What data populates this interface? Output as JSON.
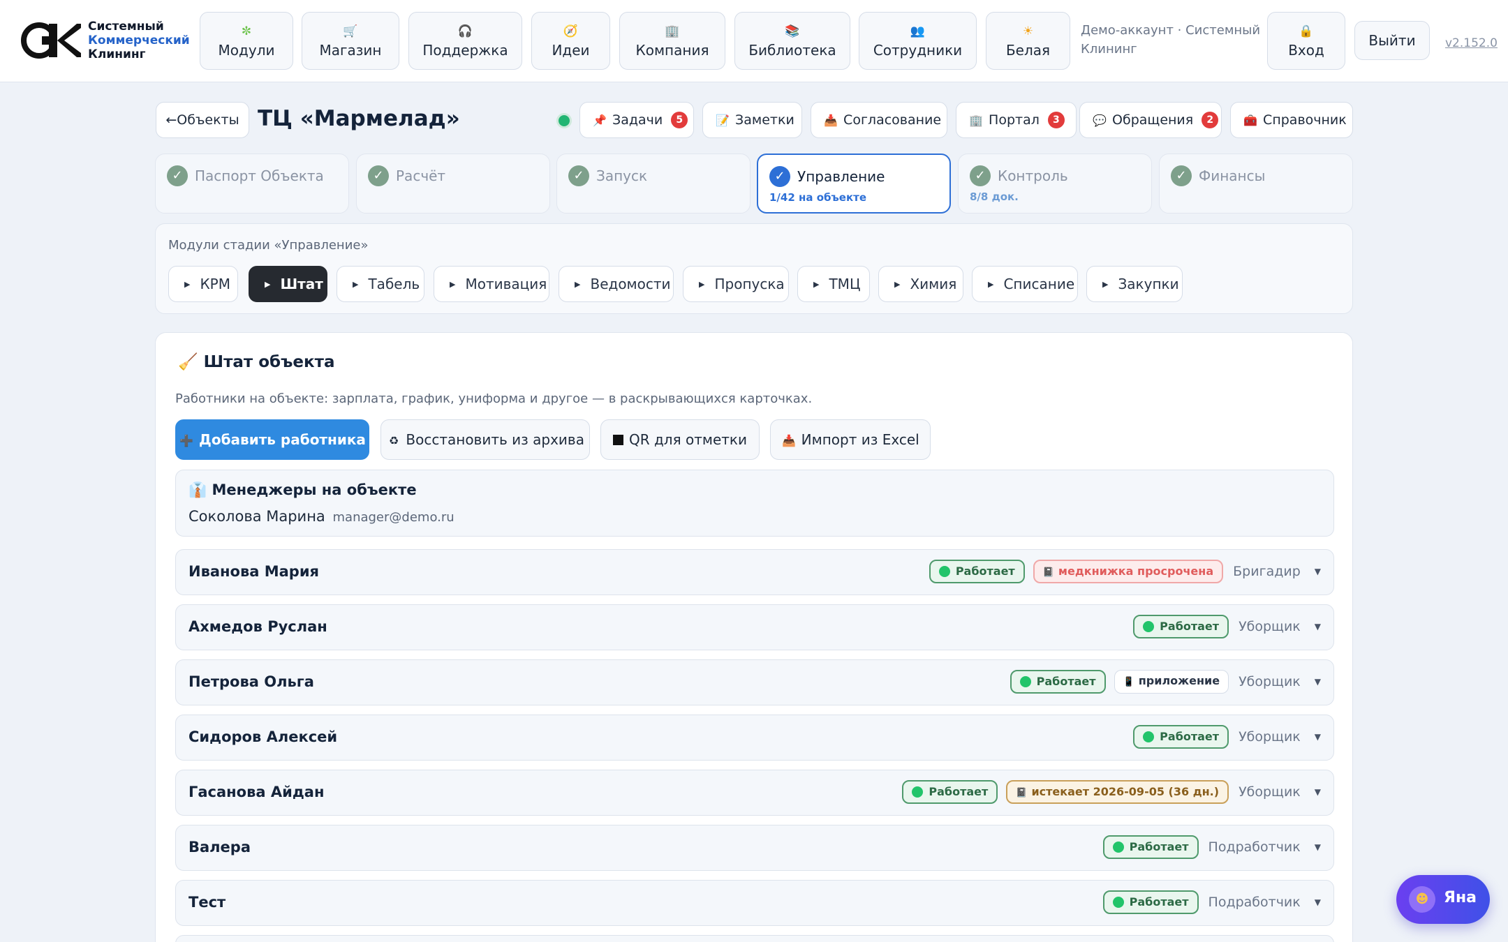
{
  "brand": {
    "line1": "Системный",
    "line2": "Коммерческий",
    "line3": "Клининг",
    "accent_color": "#2563c9"
  },
  "nav": [
    {
      "label": "Модули",
      "icon": "puzzle-icon",
      "glyph": "✼"
    },
    {
      "label": "Магазин",
      "icon": "cart-icon",
      "glyph": "🛒"
    },
    {
      "label": "Поддержка",
      "icon": "headphones-icon",
      "glyph": "🎧"
    },
    {
      "label": "Идеи",
      "icon": "compass-icon",
      "glyph": "🧭"
    },
    {
      "label": "Компания",
      "icon": "office-building-icon",
      "glyph": "🏢"
    },
    {
      "label": "Библиотека",
      "icon": "books-icon",
      "glyph": "📚"
    },
    {
      "label": "Сотрудники",
      "icon": "people-icon",
      "glyph": "👥"
    },
    {
      "label": "Белая",
      "icon": "sun-icon",
      "glyph": "☀"
    }
  ],
  "account": {
    "demo_text": "Демо-аккаунт · Системный Клининг",
    "login_label": "Вход",
    "login_icon": "lock-icon",
    "login_glyph": "🔒",
    "logout_label": "Выйти",
    "version": "v2.152.0"
  },
  "header": {
    "back_label": "←Объекты",
    "title": "ТЦ «Мармелад»",
    "status_color": "#22b573",
    "buttons": [
      {
        "label": "Задачи",
        "icon": "pin-icon",
        "glyph": "📌",
        "badge": "5"
      },
      {
        "label": "Заметки",
        "icon": "memo-icon",
        "glyph": "📝",
        "badge": ""
      },
      {
        "label": "Согласование",
        "icon": "inbox-tray-icon",
        "glyph": "📥",
        "badge": ""
      },
      {
        "label": "Портал",
        "icon": "building-icon",
        "glyph": "🏢",
        "badge": "3"
      },
      {
        "label": "Обращения",
        "icon": "speech-bubble-icon",
        "glyph": "💬",
        "badge": "2"
      },
      {
        "label": "Справочник",
        "icon": "toolbox-icon",
        "glyph": "🧰",
        "badge": ""
      }
    ]
  },
  "stages": [
    {
      "label": "Паспорт Объекта",
      "sub": "",
      "active": false
    },
    {
      "label": "Расчёт",
      "sub": "",
      "active": false
    },
    {
      "label": "Запуск",
      "sub": "",
      "active": false
    },
    {
      "label": "Управление",
      "sub": "1/42 на объекте",
      "active": true
    },
    {
      "label": "Контроль",
      "sub": "8/8 док.",
      "active": false
    },
    {
      "label": "Финансы",
      "sub": "",
      "active": false
    }
  ],
  "modules": {
    "caption": "Модули стадии «Управление»",
    "items": [
      {
        "label": "КРМ",
        "active": false
      },
      {
        "label": "Штат",
        "active": true
      },
      {
        "label": "Табель",
        "active": false
      },
      {
        "label": "Мотивация",
        "active": false
      },
      {
        "label": "Ведомости",
        "active": false
      },
      {
        "label": "Пропуска",
        "active": false
      },
      {
        "label": "ТМЦ",
        "active": false
      },
      {
        "label": "Химия",
        "active": false
      },
      {
        "label": "Списание",
        "active": false
      },
      {
        "label": "Закупки",
        "active": false
      }
    ]
  },
  "staff": {
    "title": "Штат объекта",
    "title_icon": "cleaner-person-icon",
    "title_glyph": "🧹",
    "description": "Работники на объекте: зарплата, график, униформа и другое — в раскрывающихся карточках.",
    "actions": [
      {
        "label": "Добавить работника",
        "icon": "plus-icon",
        "glyph": "➕",
        "primary": true
      },
      {
        "label": "Восстановить из архива",
        "icon": "recycle-icon",
        "glyph": "♻",
        "primary": false
      },
      {
        "label": "QR для отметки",
        "icon": "qr-icon",
        "glyph": "",
        "primary": false
      },
      {
        "label": "Импорт из Excel",
        "icon": "inbox-tray-icon",
        "glyph": "📥",
        "primary": false
      }
    ],
    "managers": {
      "title": "Менеджеры на объекте",
      "icon": "necktie-icon",
      "glyph": "👔",
      "name": "Соколова Марина",
      "email": "manager@demo.ru"
    },
    "workers": [
      {
        "name": "Иванова Мария",
        "status": "Работает",
        "tag": {
          "text": "медкнижка просрочена",
          "kind": "red",
          "icon": "notebook-icon"
        },
        "role": "Бригадир"
      },
      {
        "name": "Ахмедов Руслан",
        "status": "Работает",
        "tag": null,
        "role": "Уборщик"
      },
      {
        "name": "Петрова Ольга",
        "status": "Работает",
        "tag": {
          "text": "приложение",
          "kind": "neutral",
          "icon": "phone-icon"
        },
        "role": "Уборщик"
      },
      {
        "name": "Сидоров Алексей",
        "status": "Работает",
        "tag": null,
        "role": "Уборщик"
      },
      {
        "name": "Гасанова Айдан",
        "status": "Работает",
        "tag": {
          "text": "истекает 2026-09-05 (36 дн.)",
          "kind": "amber",
          "icon": "notebook-icon"
        },
        "role": "Уборщик"
      },
      {
        "name": "Валера",
        "status": "Работает",
        "tag": null,
        "role": "Подработчик"
      },
      {
        "name": "Тест",
        "status": "Работает",
        "tag": null,
        "role": "Подработчик"
      }
    ]
  },
  "assistant": {
    "name": "Яна",
    "icon": "assistant-avatar-icon"
  }
}
